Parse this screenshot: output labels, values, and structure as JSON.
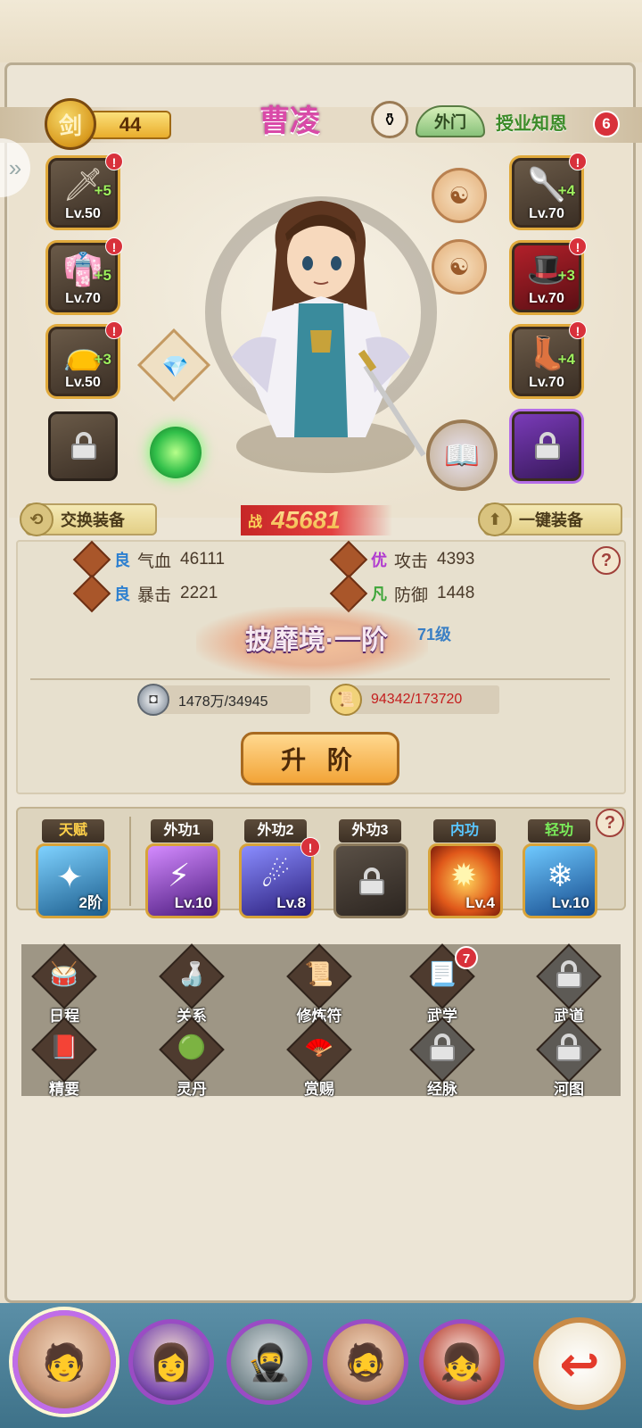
{
  "header": {
    "sect_char": "剑",
    "level": "44",
    "hero_name": "曹凌",
    "outer_tag": "外门",
    "mentor_label": "授业知恩",
    "mentor_count": "6"
  },
  "equipment_left": [
    {
      "icon": "sword-icon",
      "plus": "+5",
      "level": "Lv.50"
    },
    {
      "icon": "robe-icon",
      "plus": "+5",
      "level": "Lv.70"
    },
    {
      "icon": "belt-icon",
      "plus": "+3",
      "level": "Lv.50"
    },
    {
      "icon": "lock-icon",
      "plus": "",
      "level": ""
    }
  ],
  "equipment_right": [
    {
      "icon": "staff-icon",
      "plus": "+4",
      "level": "Lv.70"
    },
    {
      "icon": "hat-icon",
      "plus": "+3",
      "level": "Lv.70"
    },
    {
      "icon": "boots-icon",
      "plus": "+4",
      "level": "Lv.70"
    },
    {
      "icon": "lock-icon",
      "plus": "",
      "level": ""
    }
  ],
  "actions": {
    "swap_label": "交换装备",
    "auto_label": "一键装备"
  },
  "power": {
    "label": "战",
    "value": "45681"
  },
  "stats": [
    {
      "grade": "良",
      "name": "气血",
      "value": "46111",
      "grade_color": "#2c7fd0"
    },
    {
      "grade": "优",
      "name": "攻击",
      "value": "4393",
      "grade_color": "#b03ad0"
    },
    {
      "grade": "良",
      "name": "暴击",
      "value": "2221",
      "grade_color": "#2c7fd0"
    },
    {
      "grade": "凡",
      "name": "防御",
      "value": "1448",
      "grade_color": "#3fa63a"
    }
  ],
  "realm": {
    "title": "披靡境·一阶",
    "level": "71级"
  },
  "resources": {
    "silver": "1478万/34945",
    "scroll": "94342/173720"
  },
  "upgrade_label": "升 阶",
  "skills": [
    {
      "label": "天赋",
      "level": "2阶",
      "color_class": "gold",
      "icon": "talent-icon",
      "alert": ""
    },
    {
      "label": "外功1",
      "level": "Lv.10",
      "color_class": "",
      "icon": "outer-skill-1-icon",
      "alert": ""
    },
    {
      "label": "外功2",
      "level": "Lv.8",
      "color_class": "",
      "icon": "outer-skill-2-icon",
      "alert": "!"
    },
    {
      "label": "外功3",
      "level": "",
      "color_class": "",
      "icon": "lock-icon",
      "alert": ""
    },
    {
      "label": "内功",
      "level": "Lv.4",
      "color_class": "blue",
      "icon": "inner-skill-icon",
      "alert": ""
    },
    {
      "label": "轻功",
      "level": "Lv.10",
      "color_class": "green",
      "icon": "lightness-skill-icon",
      "alert": ""
    }
  ],
  "features": [
    {
      "label": "日程",
      "icon": "schedule-icon",
      "badge": "",
      "locked": false
    },
    {
      "label": "关系",
      "icon": "relation-icon",
      "badge": "",
      "locked": false
    },
    {
      "label": "修炼符",
      "icon": "talisman-icon",
      "badge": "",
      "locked": false
    },
    {
      "label": "武学",
      "icon": "martial-arts-icon",
      "badge": "7",
      "locked": false
    },
    {
      "label": "武道",
      "icon": "lock-icon",
      "badge": "",
      "locked": true
    },
    {
      "label": "精要",
      "icon": "essence-book-icon",
      "badge": "",
      "locked": false
    },
    {
      "label": "灵丹",
      "icon": "pill-icon",
      "badge": "",
      "locked": false
    },
    {
      "label": "赏赐",
      "icon": "fan-reward-icon",
      "badge": "",
      "locked": false
    },
    {
      "label": "经脉",
      "icon": "lock-icon",
      "badge": "",
      "locked": true
    },
    {
      "label": "河图",
      "icon": "lock-icon",
      "badge": "",
      "locked": true
    }
  ],
  "bottom": {
    "back_symbol": "↩"
  }
}
